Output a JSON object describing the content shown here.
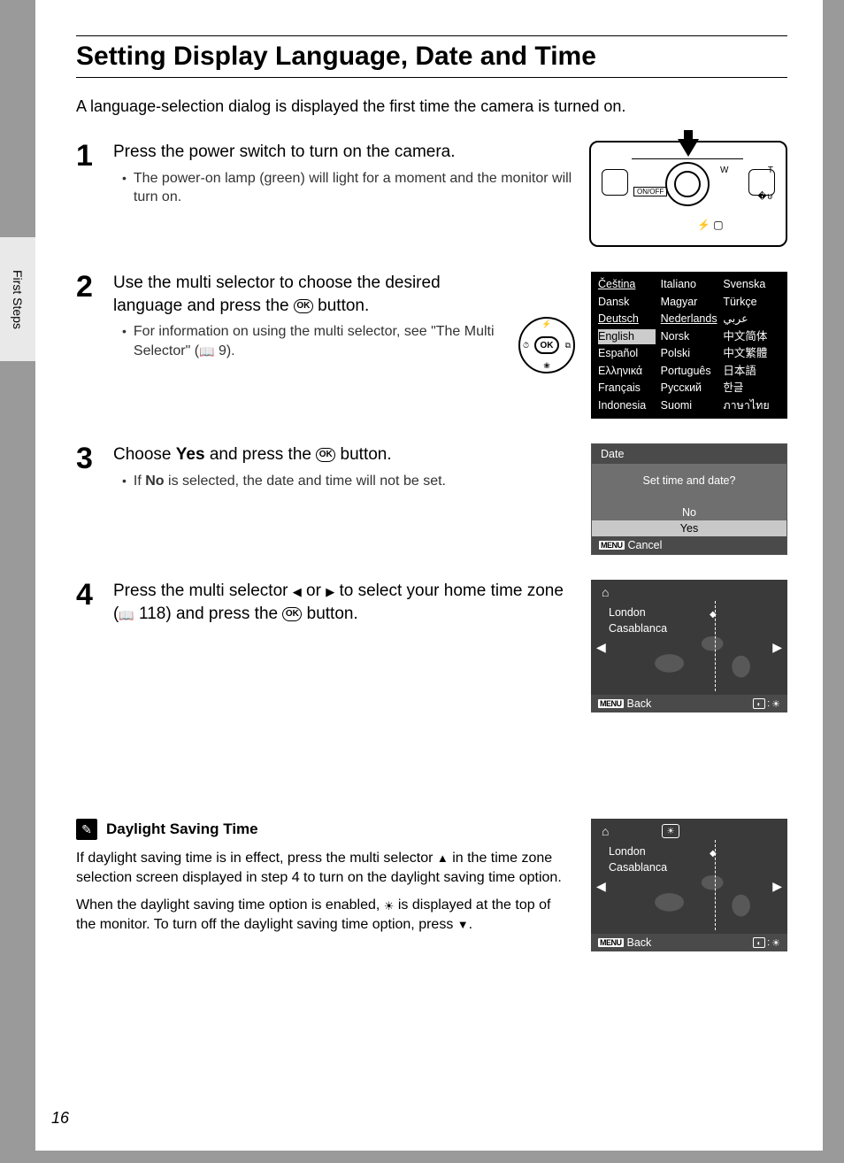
{
  "side_tab": "First Steps",
  "title": "Setting Display Language, Date and Time",
  "intro": "A language-selection dialog is displayed the first time the camera is turned on.",
  "page_number": "16",
  "steps": {
    "s1": {
      "num": "1",
      "title": "Press the power switch to turn on the camera.",
      "bullet": "The power-on lamp (green) will light for a moment and the monitor will turn on.",
      "onoff": "ON/OFF",
      "w": "W",
      "t": "T"
    },
    "s2": {
      "num": "2",
      "title_a": "Use the multi selector to choose the desired language and press the ",
      "title_b": " button.",
      "bullet_a": "For information on using the multi selector, see \"The Multi Selector\" (",
      "bullet_ref": " 9).",
      "ok": "OK"
    },
    "s3": {
      "num": "3",
      "title_a": "Choose ",
      "title_yes": "Yes",
      "title_b": " and press the ",
      "title_c": " button.",
      "bullet_a": "If ",
      "bullet_no": "No",
      "bullet_b": " is selected, the date and time will not be set."
    },
    "s4": {
      "num": "4",
      "title_a": "Press the multi selector ",
      "title_b": " or ",
      "title_c": " to select your home time zone (",
      "title_ref": " 118) and press the ",
      "title_d": " button."
    }
  },
  "languages": [
    "Čeština",
    "Italiano",
    "Svenska",
    "Dansk",
    "Magyar",
    "Türkçe",
    "Deutsch",
    "Nederlands",
    "عربي",
    "English",
    "Norsk",
    "中文简体",
    "Español",
    "Polski",
    "中文繁體",
    "Ελληνικά",
    "Português",
    "日本語",
    "Français",
    "Русский",
    "한글",
    "Indonesia",
    "Suomi",
    "ภาษาไทย"
  ],
  "date_dialog": {
    "title": "Date",
    "question": "Set time and date?",
    "opt_no": "No",
    "opt_yes": "Yes",
    "menu": "MENU",
    "cancel": "Cancel"
  },
  "tz": {
    "city1": "London",
    "city2": "Casablanca",
    "menu": "MENU",
    "back": "Back"
  },
  "dst": {
    "heading": "Daylight Saving Time",
    "p1_a": "If daylight saving time is in effect, press the multi selector ",
    "p1_b": " in the time zone selection screen displayed in step 4 to turn on the daylight saving time option.",
    "p2_a": "When the daylight saving time option is enabled, ",
    "p2_b": " is displayed at the top of the monitor. To turn off the daylight saving time option, press ",
    "p2_c": "."
  }
}
